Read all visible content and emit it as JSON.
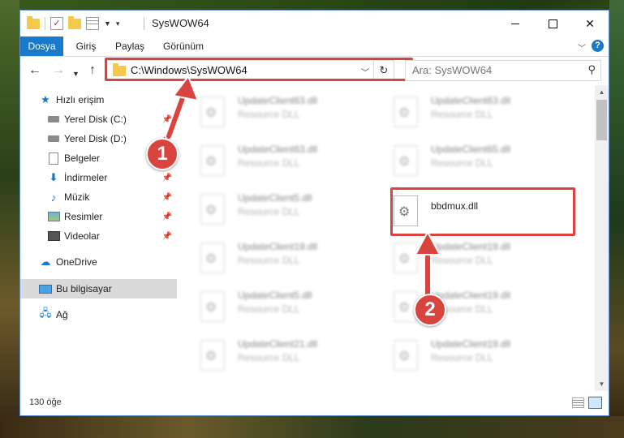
{
  "window": {
    "title": "SysWOW64"
  },
  "ribbon": {
    "tabs": [
      {
        "label": "Dosya"
      },
      {
        "label": "Giriş"
      },
      {
        "label": "Paylaş"
      },
      {
        "label": "Görünüm"
      }
    ],
    "help_glyph": "?"
  },
  "nav": {
    "address": "C:\\Windows\\SysWOW64",
    "search_placeholder": "Ara: SysWOW64"
  },
  "sidebar": {
    "items": [
      {
        "label": "Hızlı erişim",
        "icon": "star-icon"
      },
      {
        "label": "Yerel Disk (C:)",
        "icon": "drive-icon",
        "pinned": true
      },
      {
        "label": "Yerel Disk (D:)",
        "icon": "drive-icon",
        "pinned": true
      },
      {
        "label": "Belgeler",
        "icon": "documents-icon",
        "pinned": true
      },
      {
        "label": "İndirmeler",
        "icon": "downloads-icon",
        "pinned": true
      },
      {
        "label": "Müzik",
        "icon": "music-icon",
        "pinned": true
      },
      {
        "label": "Resimler",
        "icon": "pictures-icon",
        "pinned": true
      },
      {
        "label": "Videolar",
        "icon": "videos-icon",
        "pinned": true
      },
      {
        "label": "OneDrive",
        "icon": "cloud-icon"
      },
      {
        "label": "Bu bilgisayar",
        "icon": "computer-icon",
        "selected": true
      },
      {
        "label": "Ağ",
        "icon": "network-icon"
      }
    ]
  },
  "files": [
    {
      "name": "UpdateClient63.dll",
      "type": "Resource DLL"
    },
    {
      "name": "UpdateClient63.dll",
      "type": "Resource DLL"
    },
    {
      "name": "UpdateClient63.dll",
      "type": "Resource DLL"
    },
    {
      "name": "UpdateClient65.dll",
      "type": "Resource DLL"
    },
    {
      "name": "UpdateClient5.dll",
      "type": "Resource DLL"
    },
    {
      "name": "bbdmux.dll",
      "type": "",
      "highlighted": true
    },
    {
      "name": "UpdateClient19.dll",
      "type": "Resource DLL"
    },
    {
      "name": "UpdateClient19.dll",
      "type": "Resource DLL"
    },
    {
      "name": "UpdateClient5.dll",
      "type": "Resource DLL"
    },
    {
      "name": "UpdateClient19.dll",
      "type": "Resource DLL"
    },
    {
      "name": "UpdateClient21.dll",
      "type": "Resource DLL"
    },
    {
      "name": "UpdateClient19.dll",
      "type": "Resource DLL"
    }
  ],
  "status": {
    "item_count": "130 öğe"
  },
  "annotations": {
    "step1": "1",
    "step2": "2",
    "accent": "#d9443f"
  }
}
